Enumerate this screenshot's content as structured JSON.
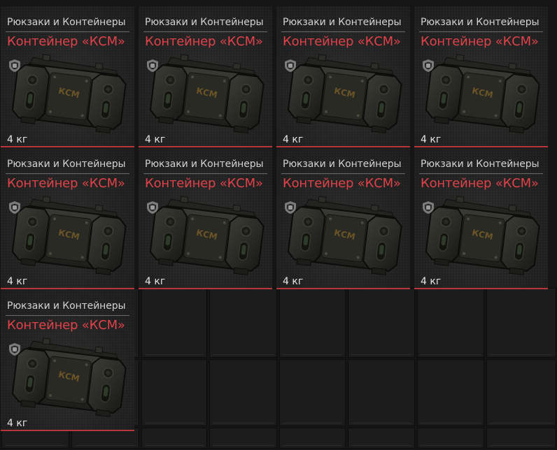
{
  "inventory": {
    "background_color": "#151515",
    "empty_cell_color": "#1c1c1c",
    "rarity_color": "#b8363c",
    "items": [
      {
        "category": "Рюкзаки и Контейнеры",
        "name": "Контейнер «КСМ»",
        "weight": "4 кг",
        "image_label": "КСМ",
        "badge_icon": "shield-icon"
      },
      {
        "category": "Рюкзаки и Контейнеры",
        "name": "Контейнер «КСМ»",
        "weight": "4 кг",
        "image_label": "КСМ",
        "badge_icon": "shield-icon"
      },
      {
        "category": "Рюкзаки и Контейнеры",
        "name": "Контейнер «КСМ»",
        "weight": "4 кг",
        "image_label": "КСМ",
        "badge_icon": "shield-icon"
      },
      {
        "category": "Рюкзаки и Контейнеры",
        "name": "Контейнер «КСМ»",
        "weight": "4 кг",
        "image_label": "КСМ",
        "badge_icon": "shield-icon"
      },
      {
        "category": "Рюкзаки и Контейнеры",
        "name": "Контейнер «КСМ»",
        "weight": "4 кг",
        "image_label": "КСМ",
        "badge_icon": "shield-icon"
      },
      {
        "category": "Рюкзаки и Контейнеры",
        "name": "Контейнер «КСМ»",
        "weight": "4 кг",
        "image_label": "КСМ",
        "badge_icon": "shield-icon"
      },
      {
        "category": "Рюкзаки и Контейнеры",
        "name": "Контейнер «КСМ»",
        "weight": "4 кг",
        "image_label": "КСМ",
        "badge_icon": "shield-icon"
      },
      {
        "category": "Рюкзаки и Контейнеры",
        "name": "Контейнер «КСМ»",
        "weight": "4 кг",
        "image_label": "КСМ",
        "badge_icon": "shield-icon"
      },
      {
        "category": "Рюкзаки и Контейнеры",
        "name": "Контейнер «КСМ»",
        "weight": "4 кг",
        "image_label": "КСМ",
        "badge_icon": "shield-icon"
      }
    ]
  }
}
